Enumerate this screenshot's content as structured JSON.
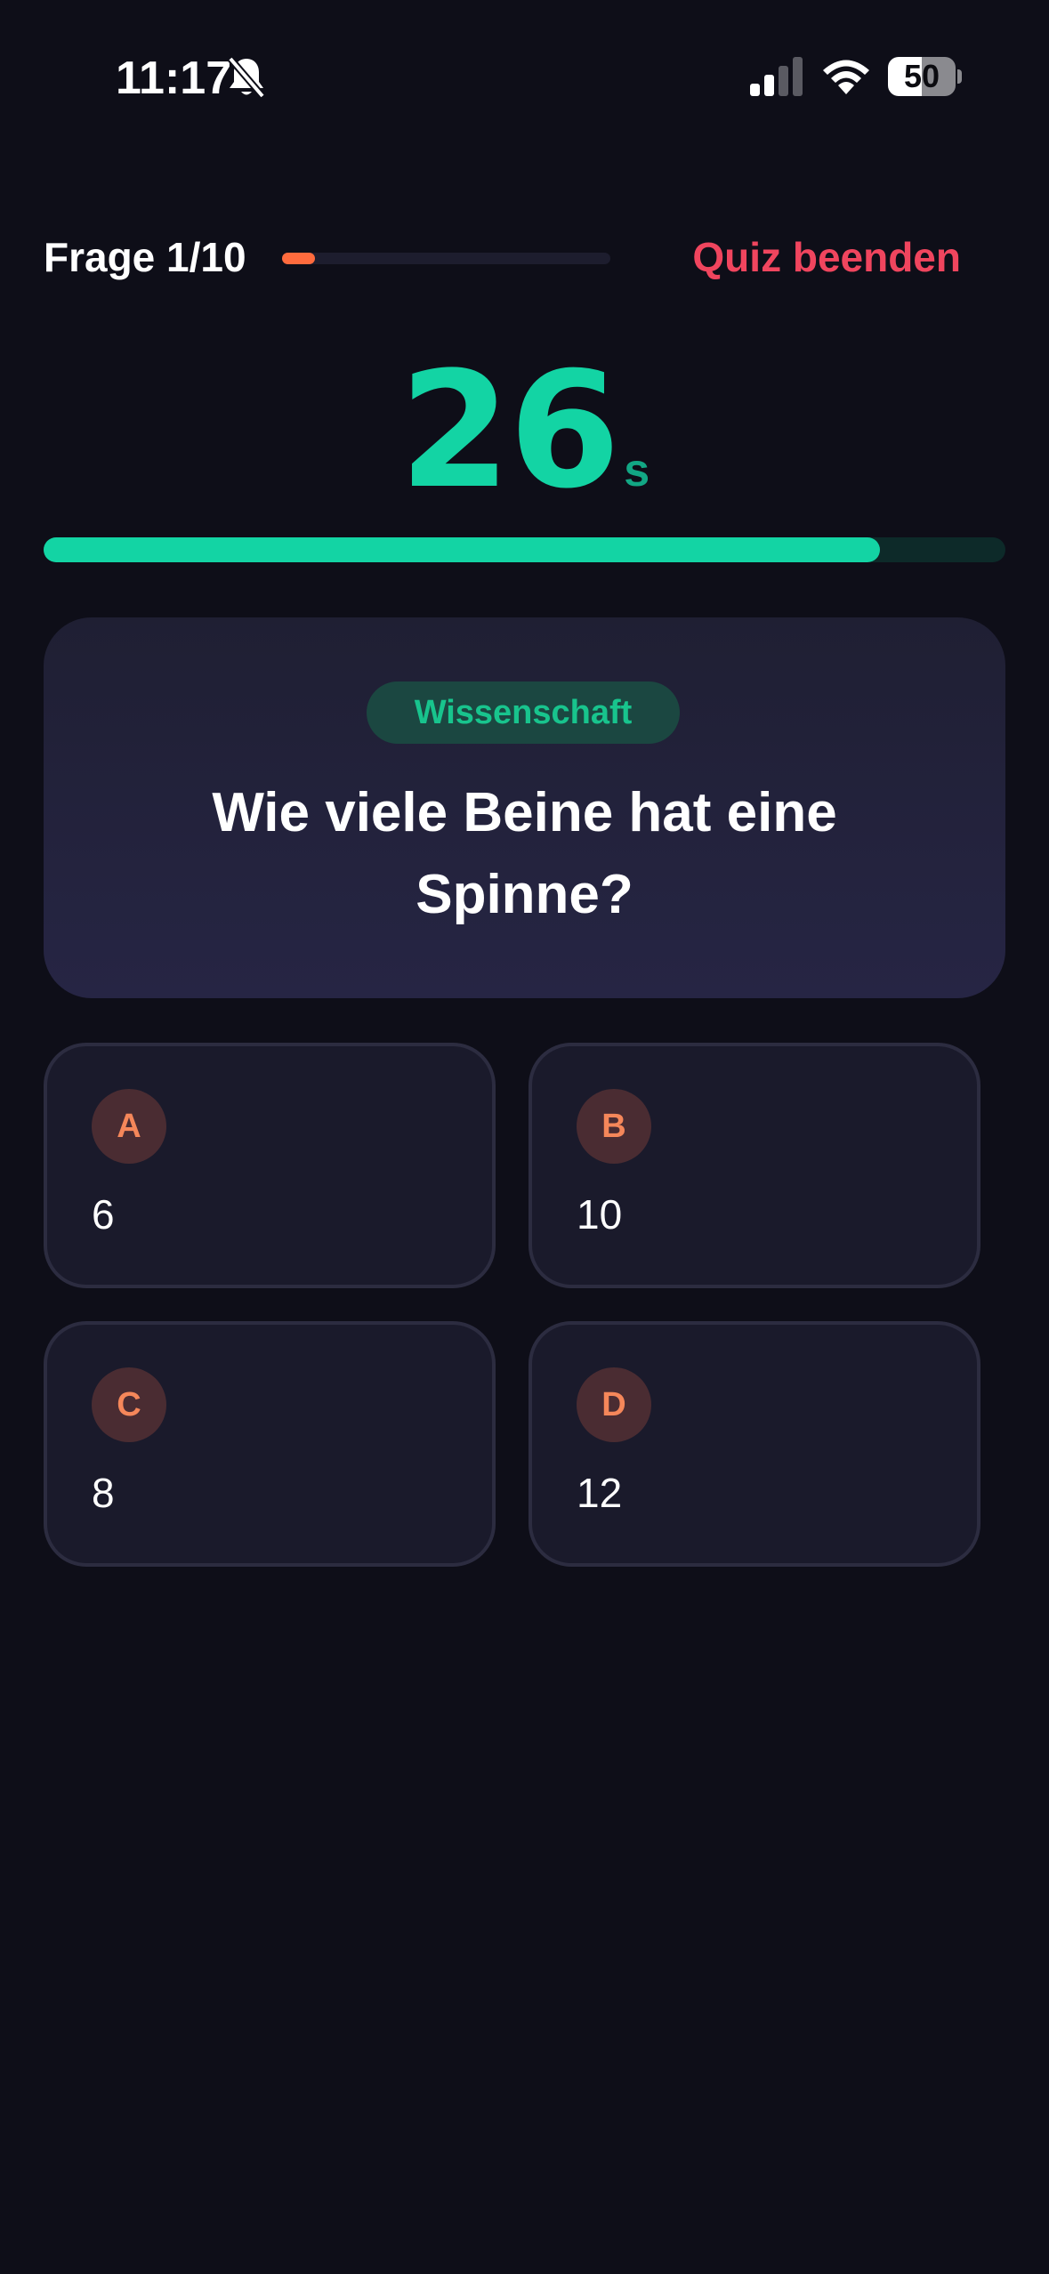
{
  "status_bar": {
    "time": "11:17",
    "battery": "50"
  },
  "header": {
    "question_counter": "Frage 1/10",
    "quiz_progress": 0.1,
    "quit_label": "Quiz beenden"
  },
  "timer": {
    "value": "26",
    "unit": "s",
    "remaining_fraction": 0.87
  },
  "question": {
    "category": "Wissenschaft",
    "text": "Wie viele Beine hat eine Spinne?"
  },
  "answers": [
    {
      "letter": "A",
      "text": "6"
    },
    {
      "letter": "B",
      "text": "10"
    },
    {
      "letter": "C",
      "text": "8"
    },
    {
      "letter": "D",
      "text": "12"
    }
  ],
  "colors": {
    "background": "#0e0e18",
    "accent_green": "#13d4a4",
    "accent_orange": "#ff6b3d",
    "quit_red": "#f0455e"
  },
  "icons": {
    "bell": "bell-slash-icon",
    "signal": "cellular-signal-icon",
    "wifi": "wifi-icon",
    "battery": "battery-icon"
  }
}
